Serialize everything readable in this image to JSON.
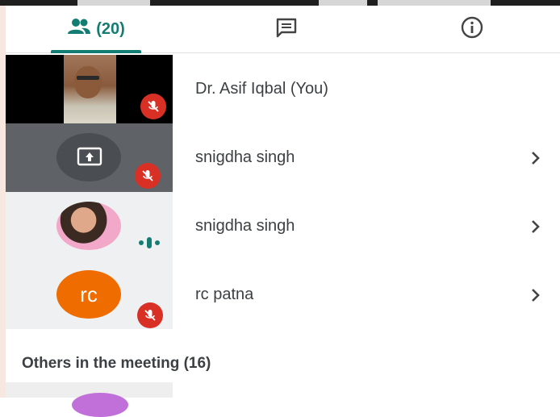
{
  "tabs": {
    "people_count": "(20)",
    "chat_icon": "chat-icon",
    "info_icon": "info-icon"
  },
  "participants": [
    {
      "name": "Dr. Asif Iqbal (You)",
      "muted": true,
      "tile": "video"
    },
    {
      "name": "snigdha singh",
      "muted": true,
      "tile": "presentation"
    },
    {
      "name": "snigdha singh",
      "muted": false,
      "speaking": true,
      "tile": "photo"
    },
    {
      "name": "rc patna",
      "muted": true,
      "tile": "initials",
      "initials": "rc"
    }
  ],
  "others": {
    "label": "Others in the meeting (16)"
  },
  "colors": {
    "accent": "#137c73",
    "muted_badge": "#d93025",
    "initials_avatar": "#ef6c00",
    "presentation_tile": "#5f6368"
  }
}
